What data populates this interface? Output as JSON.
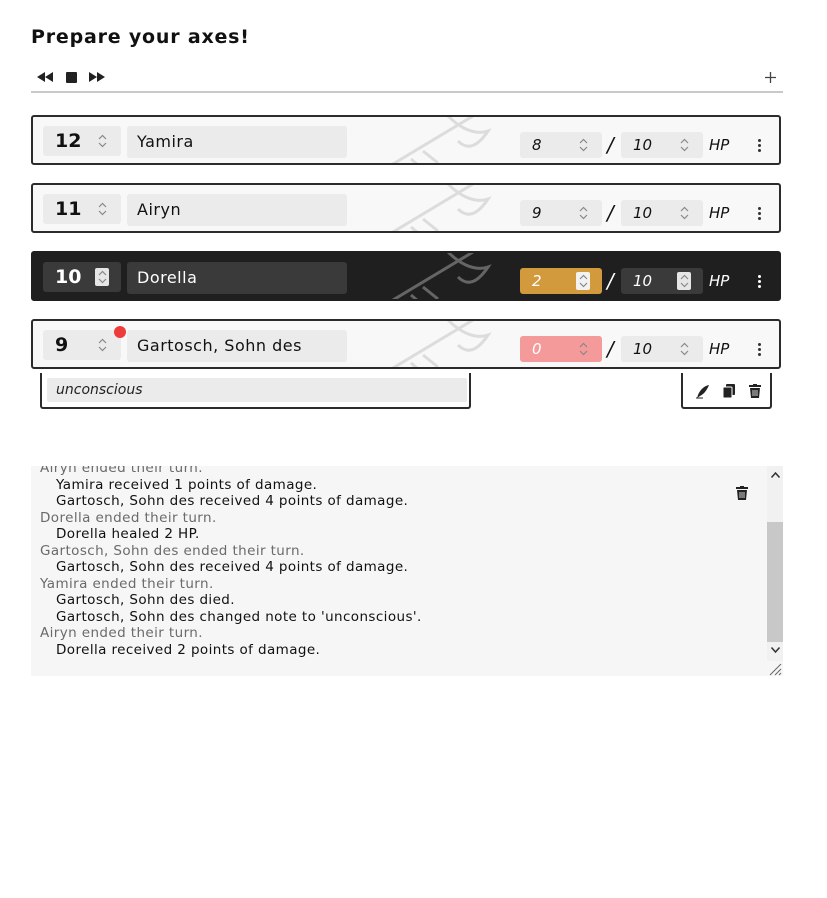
{
  "page": {
    "title": "Prepare your axes!"
  },
  "toolbar": {
    "prev_icon": "rewind-icon",
    "stop_icon": "stop-icon",
    "next_icon": "fast-forward-icon",
    "add_icon": "plus-icon"
  },
  "combatants": [
    {
      "initiative": "12",
      "name": "Yamira",
      "hp": "8",
      "max_hp": "10",
      "hp_label": "HP",
      "active": false,
      "status": "normal"
    },
    {
      "initiative": "11",
      "name": "Airyn",
      "hp": "9",
      "max_hp": "10",
      "hp_label": "HP",
      "active": false,
      "status": "normal"
    },
    {
      "initiative": "10",
      "name": "Dorella",
      "hp": "2",
      "max_hp": "10",
      "hp_label": "HP",
      "active": true,
      "status": "low"
    },
    {
      "initiative": "9",
      "name": "Gartosch, Sohn des",
      "hp": "0",
      "max_hp": "10",
      "hp_label": "HP",
      "active": false,
      "status": "dead",
      "has_note_badge": true
    }
  ],
  "note": {
    "value": "unconscious"
  },
  "note_actions": {
    "edit_icon": "quill-pen-icon",
    "copy_icon": "copy-icon",
    "delete_icon": "trash-icon"
  },
  "log": {
    "lines": [
      {
        "kind": "turn",
        "text": "Airyn ended their turn."
      },
      {
        "kind": "event",
        "text": "Yamira received 1 points of damage."
      },
      {
        "kind": "event",
        "text": "Gartosch, Sohn des received 4 points of damage."
      },
      {
        "kind": "turn",
        "text": "Dorella ended their turn."
      },
      {
        "kind": "event",
        "text": "Dorella healed 2 HP."
      },
      {
        "kind": "turn",
        "text": "Gartosch, Sohn des ended their turn."
      },
      {
        "kind": "event",
        "text": "Gartosch, Sohn des received 4 points of damage."
      },
      {
        "kind": "turn",
        "text": "Yamira ended their turn."
      },
      {
        "kind": "event",
        "text": "Gartosch, Sohn des died."
      },
      {
        "kind": "event",
        "text": "Gartosch, Sohn des changed note to 'unconscious'."
      },
      {
        "kind": "turn",
        "text": "Airyn ended their turn."
      },
      {
        "kind": "event",
        "text": "Dorella received 2 points of damage."
      }
    ],
    "clear_icon": "trash-icon"
  },
  "colors": {
    "active_row": "#1f1f1f",
    "low_hp": "#d29a3c",
    "dead_hp": "#f59a9a",
    "note_badge": "#ef3a3a"
  }
}
